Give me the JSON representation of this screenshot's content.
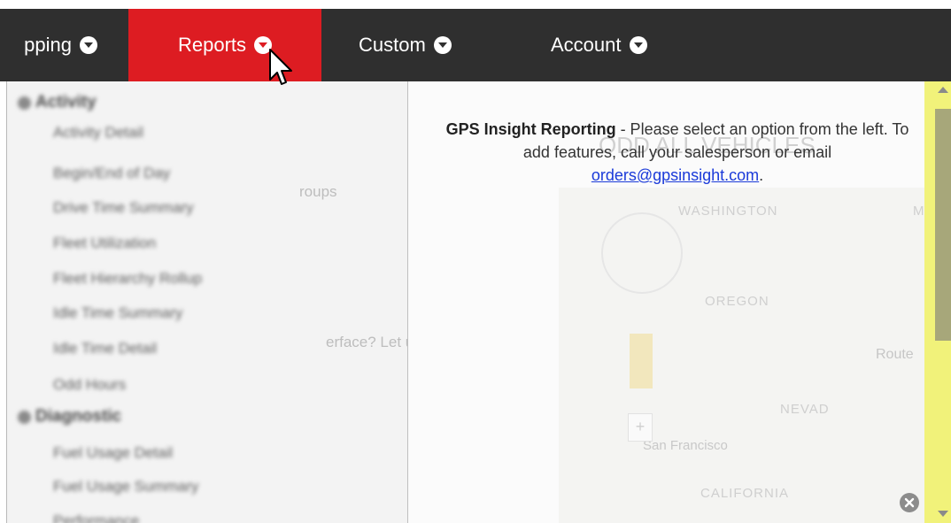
{
  "nav": {
    "items": [
      {
        "label": "pping"
      },
      {
        "label": "Reports"
      },
      {
        "label": "Custom"
      },
      {
        "label": "Account"
      }
    ]
  },
  "reports_menu": {
    "sections": [
      {
        "heading": "Activity",
        "items": [
          "Activity Detail",
          "Begin/End of Day",
          "Drive Time Summary",
          "Fleet Utilization",
          "Fleet Hierarchy Rollup",
          "Idle Time Summary",
          "Idle Time Detail",
          "Odd Hours"
        ]
      },
      {
        "heading": "Diagnostic",
        "items": [
          "Fuel Usage Detail",
          "Fuel Usage Summary",
          "Performance"
        ]
      }
    ]
  },
  "background": {
    "groups_text": "roups",
    "feedback_text": "erface? Let us hear",
    "map_title": "ODD ALL VEHICLES",
    "map_labels": [
      "WASHINGTON",
      "OREGON",
      "NEVAD",
      "San Francisco",
      "CALIFORNIA",
      "Route",
      "MO"
    ]
  },
  "message": {
    "bold": "GPS Insight Reporting",
    "text": " - Please select an option from the left. To add features, call your salesperson or email ",
    "email": "orders@gpsinsight.com",
    "end": "."
  },
  "colors": {
    "nav_bg": "#2f2f2f",
    "active_tab": "#dd1c22",
    "scrollbar": "#f1f27a",
    "link": "#1a3ad9"
  }
}
